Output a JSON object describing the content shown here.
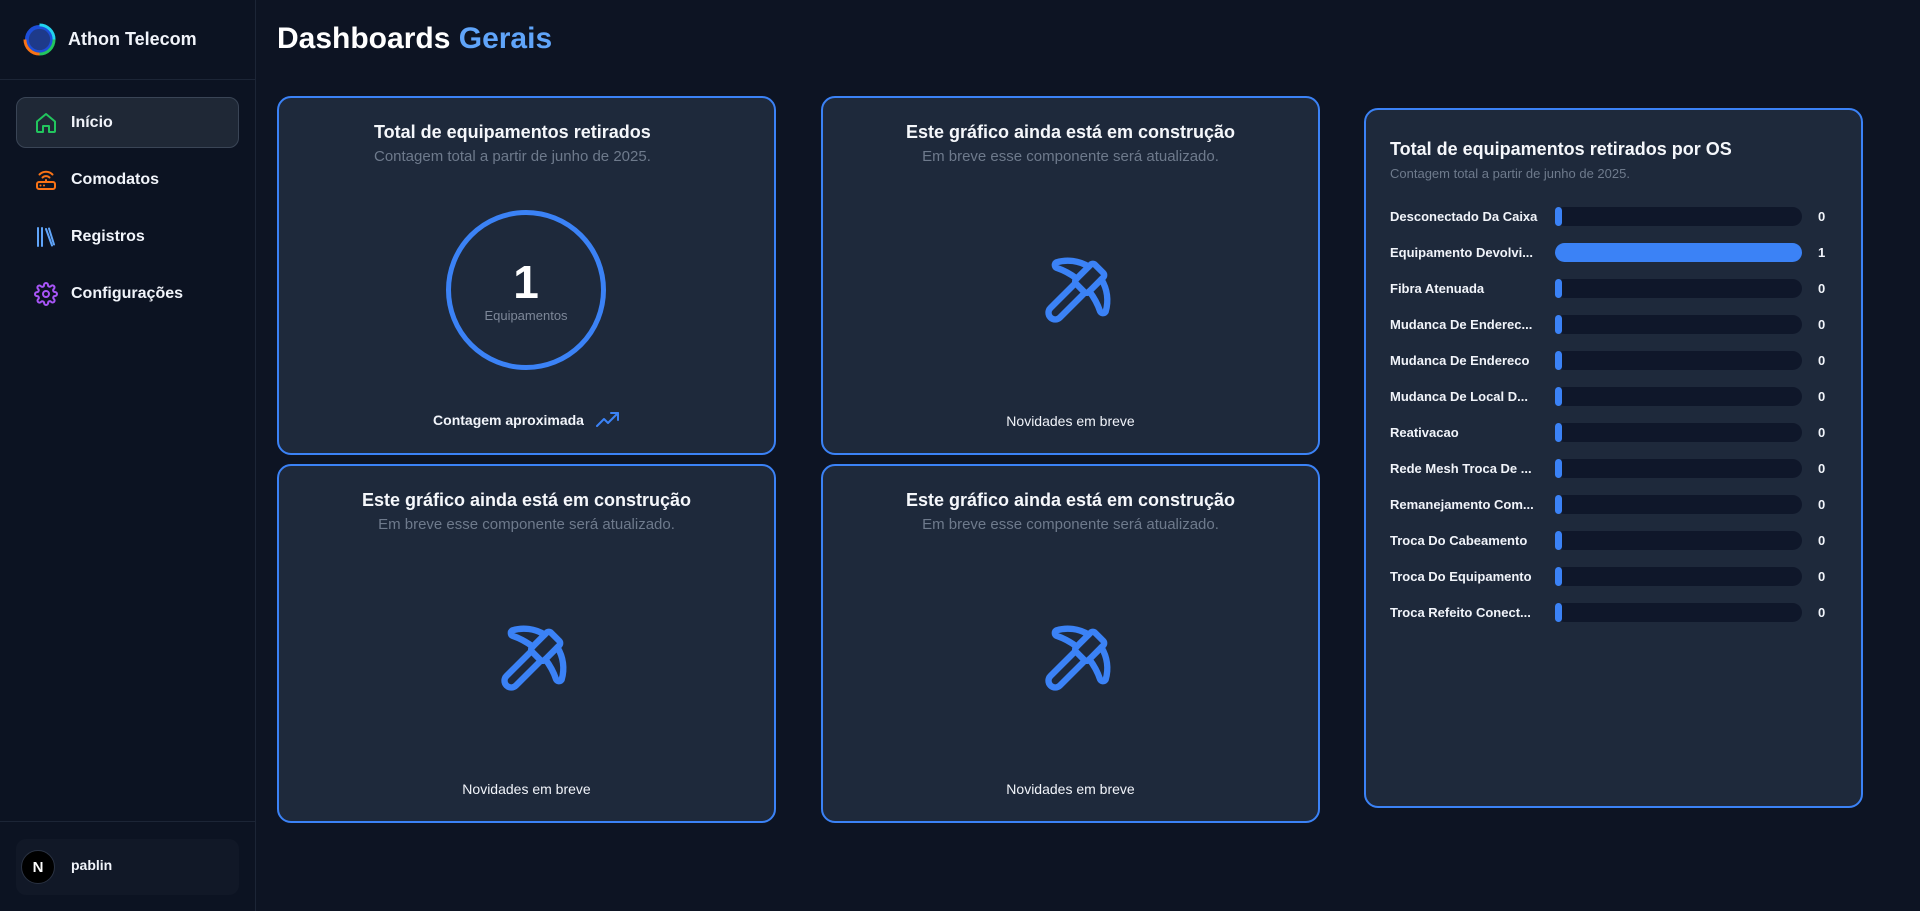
{
  "app": {
    "name": "Athon Telecom"
  },
  "sidebar": {
    "items": [
      {
        "label": "Início",
        "icon": "home-icon",
        "active": true,
        "color": "#22c55e"
      },
      {
        "label": "Comodatos",
        "icon": "router-icon",
        "active": false,
        "color": "#f97316"
      },
      {
        "label": "Registros",
        "icon": "library-icon",
        "active": false,
        "color": "#60a5fa"
      },
      {
        "label": "Configurações",
        "icon": "gear-icon",
        "active": false,
        "color": "#a855f7"
      }
    ],
    "user": {
      "name": "pablin",
      "avatar_letter": "N"
    }
  },
  "page": {
    "title": "Dashboards",
    "title_accent": "Gerais"
  },
  "cards": {
    "total": {
      "title": "Total de equipamentos retirados",
      "subtitle": "Contagem total a partir de junho de 2025.",
      "value": "1",
      "value_label": "Equipamentos",
      "footer": "Contagem aproximada"
    },
    "construction": {
      "title": "Este gráfico ainda está em construção",
      "subtitle": "Em breve esse componente será atualizado.",
      "footer": "Novidades em breve"
    }
  },
  "colors": {
    "accent": "#3b82f6",
    "card_bg": "#1e293b",
    "page_bg": "#0d1423"
  },
  "chart_data": {
    "type": "bar",
    "orientation": "horizontal",
    "title": "Total de equipamentos retirados por OS",
    "subtitle": "Contagem total a partir de junho de 2025.",
    "categories": [
      "Desconectado Da Caixa",
      "Equipamento Devolvi...",
      "Fibra Atenuada",
      "Mudanca De Enderec...",
      "Mudanca De Endereco",
      "Mudanca De Local D...",
      "Reativacao",
      "Rede Mesh Troca De ...",
      "Remanejamento Com...",
      "Troca Do Cabeamento",
      "Troca Do Equipamento",
      "Troca Refeito Conect..."
    ],
    "values": [
      0,
      1,
      0,
      0,
      0,
      0,
      0,
      0,
      0,
      0,
      0,
      0
    ],
    "xlim": [
      0,
      1
    ]
  }
}
